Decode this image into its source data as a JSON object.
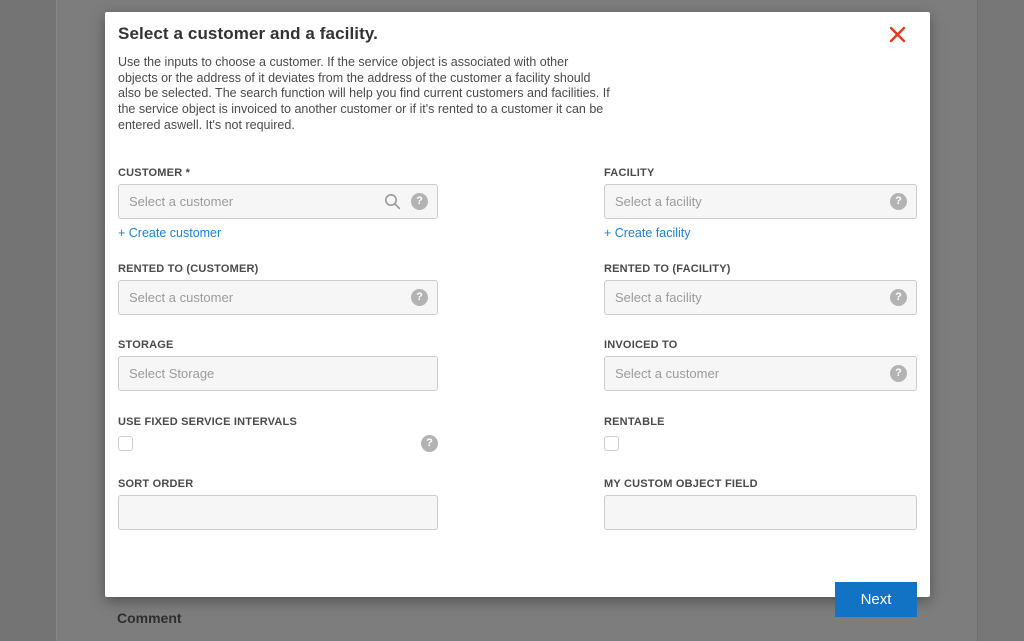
{
  "background": {
    "comment_label": "Comment"
  },
  "modal": {
    "title": "Select a customer and a facility.",
    "description": "Use the inputs to choose a customer. If the service object is associated with other objects or the address of it deviates from the address of the customer a facility should also be selected. The search function will help you find current customers and facilities. If the service object is invoiced to another customer or if it's rented to a customer it can be entered aswell. It's not required.",
    "help_icon_glyph": "?",
    "fields": {
      "customer": {
        "label": "CUSTOMER *",
        "placeholder": "Select a customer",
        "value": "",
        "create_link": "+ Create customer"
      },
      "facility": {
        "label": "FACILITY",
        "placeholder": "Select a facility",
        "value": "",
        "create_link": "+ Create facility"
      },
      "rented_to_customer": {
        "label": "RENTED TO (CUSTOMER)",
        "placeholder": "Select a customer",
        "value": ""
      },
      "rented_to_facility": {
        "label": "RENTED TO (FACILITY)",
        "placeholder": "Select a facility",
        "value": ""
      },
      "storage": {
        "label": "STORAGE",
        "placeholder": "Select Storage",
        "value": ""
      },
      "invoiced_to": {
        "label": "INVOICED TO",
        "placeholder": "Select a customer",
        "value": ""
      },
      "use_fixed_service_intervals": {
        "label": "USE FIXED SERVICE INTERVALS",
        "checked": false
      },
      "rentable": {
        "label": "RENTABLE",
        "checked": false
      },
      "sort_order": {
        "label": "SORT ORDER",
        "value": ""
      },
      "my_custom_object_field": {
        "label": "MY CUSTOM OBJECT FIELD",
        "value": ""
      }
    },
    "buttons": {
      "next": "Next"
    },
    "colors": {
      "accent_blue": "#1273c4",
      "link_blue": "#1a82d2",
      "close_red": "#e23a1b",
      "overlay_gray": "#7d7d7d"
    }
  }
}
